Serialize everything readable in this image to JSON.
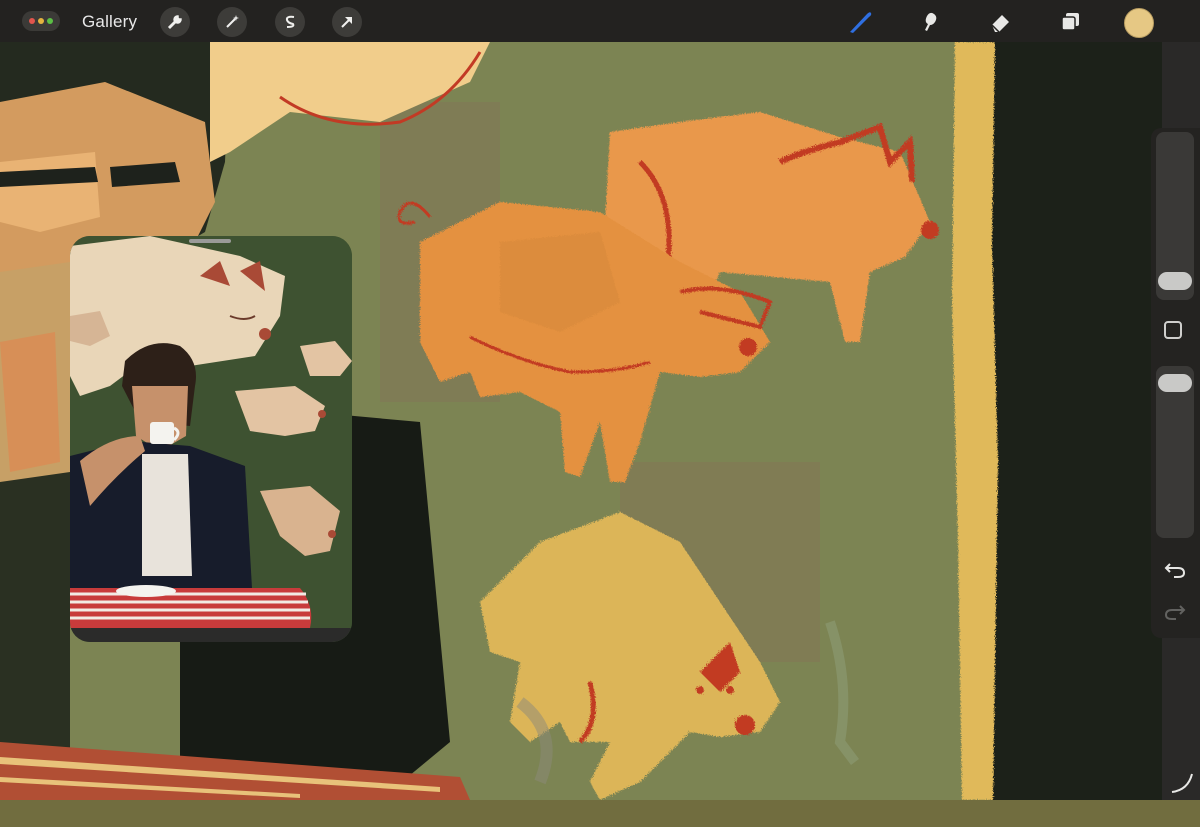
{
  "topbar": {
    "gallery_label": "Gallery",
    "left_tools": [
      "wrench-icon",
      "magic-wand-icon",
      "selection-s-icon",
      "transform-arrow-icon"
    ],
    "right_tools": [
      "brush-icon",
      "smudge-icon",
      "eraser-icon",
      "layers-icon"
    ],
    "active_tool": "brush-icon",
    "active_tool_color": "#2f6fe0",
    "current_color": "#e6c884",
    "window_dots": [
      "#e2554d",
      "#e4b33f",
      "#5bbf45"
    ]
  },
  "sidebar": {
    "controls": [
      "brush-size-slider",
      "modify-button",
      "opacity-slider",
      "undo-icon",
      "redo-icon"
    ],
    "brush_size_level": 0.12,
    "opacity_level": 0.95
  },
  "reference": {
    "type": "photo-reference",
    "subject": "photo"
  },
  "canvas": {
    "palette": [
      "#7b8454",
      "#e79a4c",
      "#c35a2b",
      "#e0bd62",
      "#1c211a",
      "#f0cc88"
    ]
  }
}
